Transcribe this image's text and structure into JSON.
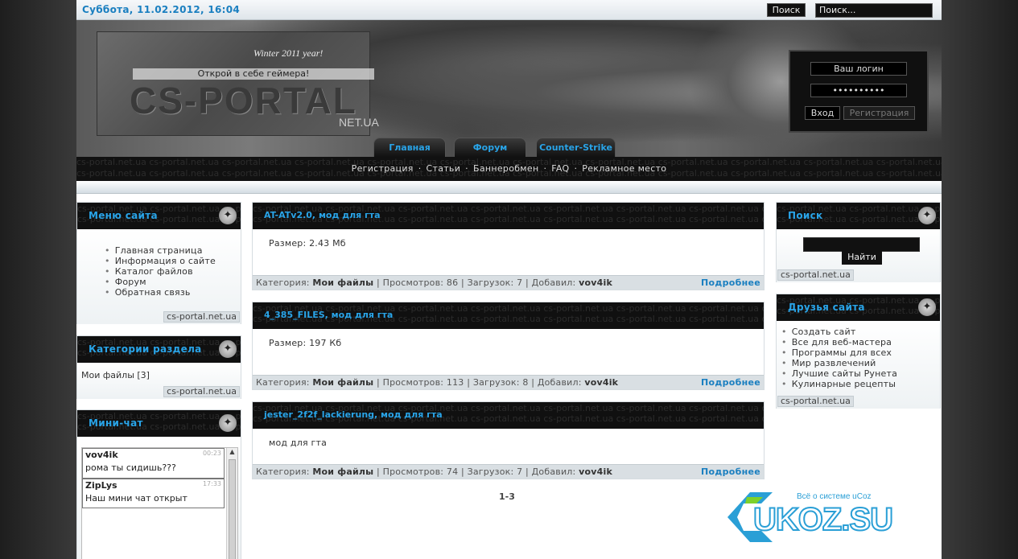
{
  "topbar": {
    "datetime": "Суббота, 11.02.2012, 16:04",
    "search_button": "Поиск",
    "search_value": "Поиск..."
  },
  "header": {
    "logo_winter": "Winter 2011 year!",
    "logo_slogan": "Открой в себе геймера!",
    "logo_title": "CS-PORTAL",
    "logo_net": "NET.UA",
    "login_placeholder": "Ваш логин",
    "password_value": "••••••••••",
    "login_button": "Вход",
    "register_button": "Регистрация",
    "tabs": [
      "Главная",
      "Форум",
      "Counter-Strike"
    ]
  },
  "nav": {
    "links": [
      "Регистрация",
      "Статьи",
      "Баннеробмен",
      "FAQ",
      "Рекламное место"
    ],
    "separator": "·",
    "watermark": "cs-portal.net.ua cs-portal.net.ua cs-portal.net.ua cs-portal.net.ua cs-portal.net.ua cs-portal.net.ua cs-portal.net.ua cs-portal.net.ua cs-portal.net.ua cs-portal.net.ua cs-portal.net.ua cs-portal.net.ua cs-portal.net.ua cs-portal.net.ua"
  },
  "left": {
    "menu": {
      "title": "Меню сайта",
      "items": [
        "Главная страница",
        "Информация о сайте",
        "Каталог файлов",
        "Форум",
        "Обратная связь"
      ],
      "footer": "cs-portal.net.ua"
    },
    "categories": {
      "title": "Категории раздела",
      "item": "Мои файлы [3]",
      "footer": "cs-portal.net.ua"
    },
    "chat": {
      "title": "Мини-чат",
      "messages": [
        {
          "user": "vov4ik",
          "time": "00:23",
          "text": "рома ты сидишь???"
        },
        {
          "user": "ZipLys",
          "time": "17:33",
          "text": "Наш мини чат открыт"
        }
      ]
    }
  },
  "entries": [
    {
      "title": "AT-ATv2.0, мод для гта",
      "body": "Размер: 2.43 Мб",
      "category_label": "Категория:",
      "category": "Мои файлы",
      "views_label": "Просмотров:",
      "views": "86",
      "downloads_label": "Загрузок:",
      "downloads": "7",
      "added_label": "Добавил:",
      "author": "vov4ik",
      "more": "Подробнее"
    },
    {
      "title": "4_385_FILES, мод для гта",
      "body": "Размер: 197 Кб",
      "category_label": "Категория:",
      "category": "Мои файлы",
      "views_label": "Просмотров:",
      "views": "113",
      "downloads_label": "Загрузок:",
      "downloads": "8",
      "added_label": "Добавил:",
      "author": "vov4ik",
      "more": "Подробнее"
    },
    {
      "title": "jester_2f2f_lackierung, мод для гта",
      "body": "мод для гта",
      "category_label": "Категория:",
      "category": "Мои файлы",
      "views_label": "Просмотров:",
      "views": "74",
      "downloads_label": "Загрузок:",
      "downloads": "7",
      "added_label": "Добавил:",
      "author": "vov4ik",
      "more": "Подробнее"
    }
  ],
  "pager": "1-3",
  "right": {
    "search": {
      "title": "Поиск",
      "button": "Найти",
      "footer": "cs-portal.net.ua"
    },
    "friends": {
      "title": "Друзья сайта",
      "items": [
        "Создать сайт",
        "Все для веб-мастера",
        "Программы для всех",
        "Мир развлечений",
        "Лучшие сайты Рунета",
        "Кулинарные рецепты"
      ],
      "footer": "cs-portal.net.ua"
    }
  },
  "ucoz": {
    "caption": "Всё о системе uCoz",
    "logo": "UKOZ.SU"
  },
  "colors": {
    "accent": "#29a4e8",
    "link": "#1a7fc0",
    "dark": "#101010"
  }
}
